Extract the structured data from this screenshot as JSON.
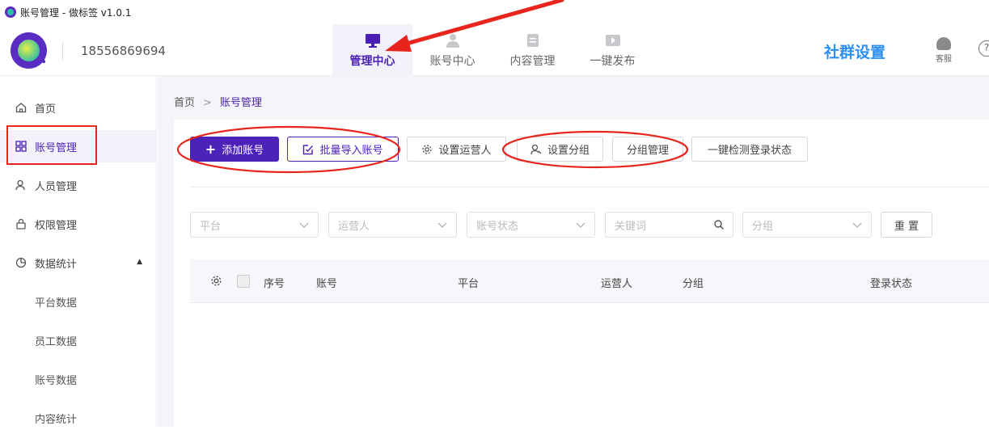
{
  "window": {
    "title": "账号管理 - 做标签 v1.0.1"
  },
  "header": {
    "phone": "18556869694",
    "nav": [
      {
        "label": "管理中心",
        "icon": "monitor-icon",
        "active": true
      },
      {
        "label": "账号中心",
        "icon": "user-icon",
        "active": false
      },
      {
        "label": "内容管理",
        "icon": "document-icon",
        "active": false
      },
      {
        "label": "一键发布",
        "icon": "play-icon",
        "active": false
      }
    ],
    "community_label": "社群设置",
    "service_label": "客服",
    "help_label": "?"
  },
  "sidebar": {
    "items": [
      {
        "label": "首页",
        "icon": "home-icon"
      },
      {
        "label": "账号管理",
        "icon": "grid-icon",
        "active": true
      },
      {
        "label": "人员管理",
        "icon": "person-icon"
      },
      {
        "label": "权限管理",
        "icon": "lock-icon"
      },
      {
        "label": "数据统计",
        "icon": "pie-icon",
        "expanded": true
      },
      {
        "label": "平台数据",
        "sub": true
      },
      {
        "label": "员工数据",
        "sub": true
      },
      {
        "label": "账号数据",
        "sub": true
      },
      {
        "label": "内容统计",
        "sub": true
      }
    ]
  },
  "breadcrumb": {
    "home": "首页",
    "sep": ">",
    "current": "账号管理"
  },
  "toolbar": {
    "add_account": "添加账号",
    "batch_import": "批量导入账号",
    "set_operator": "设置运营人",
    "set_group": "设置分组",
    "group_manage": "分组管理",
    "check_login": "一键检测登录状态"
  },
  "filters": {
    "platform": "平台",
    "operator": "运营人",
    "account_status": "账号状态",
    "keyword": "关键词",
    "group": "分组",
    "reset": "重 置"
  },
  "table": {
    "columns": [
      "序号",
      "账号",
      "平台",
      "运营人",
      "分组",
      "登录状态"
    ]
  },
  "colors": {
    "accent": "#4d22b8",
    "annotation": "#e8251d",
    "link": "#2e8ff0"
  }
}
